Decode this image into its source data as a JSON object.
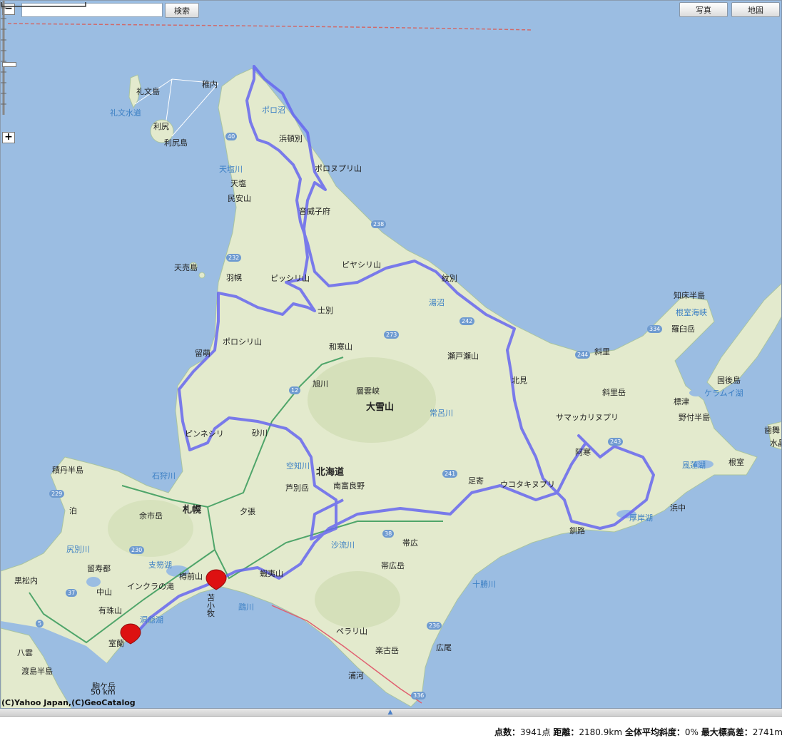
{
  "search": {
    "value": "",
    "button": "検索"
  },
  "toolbar": {
    "photo_button": "写真",
    "map_button": "地図"
  },
  "zoom": {
    "minus": "−",
    "plus": "+"
  },
  "scale_label": "50 km",
  "copyright": "(C)Yahoo Japan,(C)GeoCatalog",
  "stats": {
    "points_label": "点数：",
    "points_value": "3941点",
    "distance_label": "距離：",
    "distance_value": "2180.9km",
    "slope_label": "全体平均斜度：",
    "slope_value": "0%",
    "elev_label": "最大標高差：",
    "elev_value": "2741m"
  },
  "colors": {
    "sea": "#9bbde2",
    "land": "#e4ebce",
    "route": "#6666ee",
    "marker": "#dd1111"
  },
  "labels": {
    "rebun": "礼文島",
    "rebun_channel": "礼文水道",
    "rishiri": "利尻",
    "rishiri_island": "利尻島",
    "wakkanai": "稚内",
    "porono": "ポロ沼",
    "hamatonbetsu": "浜頓別",
    "poronupuri": "ポロヌプリ山",
    "teshio_river": "天塩川",
    "teshio": "天塩",
    "minyasu": "民安山",
    "otoineppu": "音威子府",
    "teuri": "天売島",
    "haboro": "羽幌",
    "pisshiri": "ピッシリ山",
    "piyashiri": "ピヤシリ山",
    "monbetsu": "紋別",
    "saroma": "湯沼",
    "shibetsu": "士別",
    "poroshiri": "ポロシリ山",
    "rumoi": "留萌",
    "wassamu": "和寒山",
    "asahikawa": "旭川",
    "sobetsu": "層雲峡",
    "daisetsu": "大雪山",
    "setose": "瀬戸瀬山",
    "kitami": "北見",
    "shari": "斜里",
    "shiretoko": "知床半島",
    "nemuro_strait": "根室海峡",
    "rausu": "羅臼岳",
    "kunashiri": "国後島",
    "shari_dake": "斜里岳",
    "shibetsu_e": "標津",
    "notsuke": "野付半島",
    "samakkari": "サマッカリヌプリ",
    "nemuro": "根室",
    "pinneshiri": "ピンネシリ",
    "sunagawa": "砂川",
    "ishikari_river": "石狩川",
    "sorachi": "空知川",
    "hokkaido": "北海道",
    "minamifurano": "南富良野",
    "ashibetsu": "芦別岳",
    "tokoro": "常呂川",
    "ashoro": "足寄",
    "utotakine": "ウコタキヌプリ",
    "akan": "阿寒",
    "shakotan": "積丹半島",
    "tomari": "泊",
    "yoichi": "余市岳",
    "sapporo": "札幌",
    "yubari": "夕張",
    "shirikubetsu": "尻別川",
    "rusutsu": "留寿都",
    "shikotsu": "支笏湖",
    "tarumae": "樽前山",
    "inkura": "インクラの滝",
    "kuromatsunai": "黒松内",
    "nakayama": "中山",
    "usu": "有珠山",
    "muroran": "室蘭",
    "yakumo": "八雲",
    "oshima": "渡島半島",
    "komagatake": "駒ケ岳",
    "tomakomai": "苫小牧",
    "mukawa": "鵡川",
    "ezo": "蝦夷山",
    "saru": "沙流川",
    "obihiro": "帯広",
    "obihiro_dake": "帯広岳",
    "tokachi": "十勝川",
    "pera": "ペラリ山",
    "rakko": "楽古岳",
    "hiroo": "広尾",
    "urakawa": "浦河",
    "kushiro": "釧路",
    "akkeshi": "厚岸湖",
    "hamanaka": "浜中",
    "furen": "風蓮湖",
    "kuramui": "ケラムイ湖",
    "habomai": "歯舞",
    "mizu": "水晶",
    "toubetsu": "洞爺湖"
  },
  "route_numbers": {
    "r40": "40",
    "r238": "238",
    "r232": "232",
    "r273": "273",
    "r242": "242",
    "r12": "12",
    "r334": "334",
    "r244": "244",
    "r243": "243",
    "r241": "241",
    "r38": "38",
    "r229": "229",
    "r230": "230",
    "r37": "37",
    "r236": "236",
    "r336": "336",
    "r5": "5"
  }
}
